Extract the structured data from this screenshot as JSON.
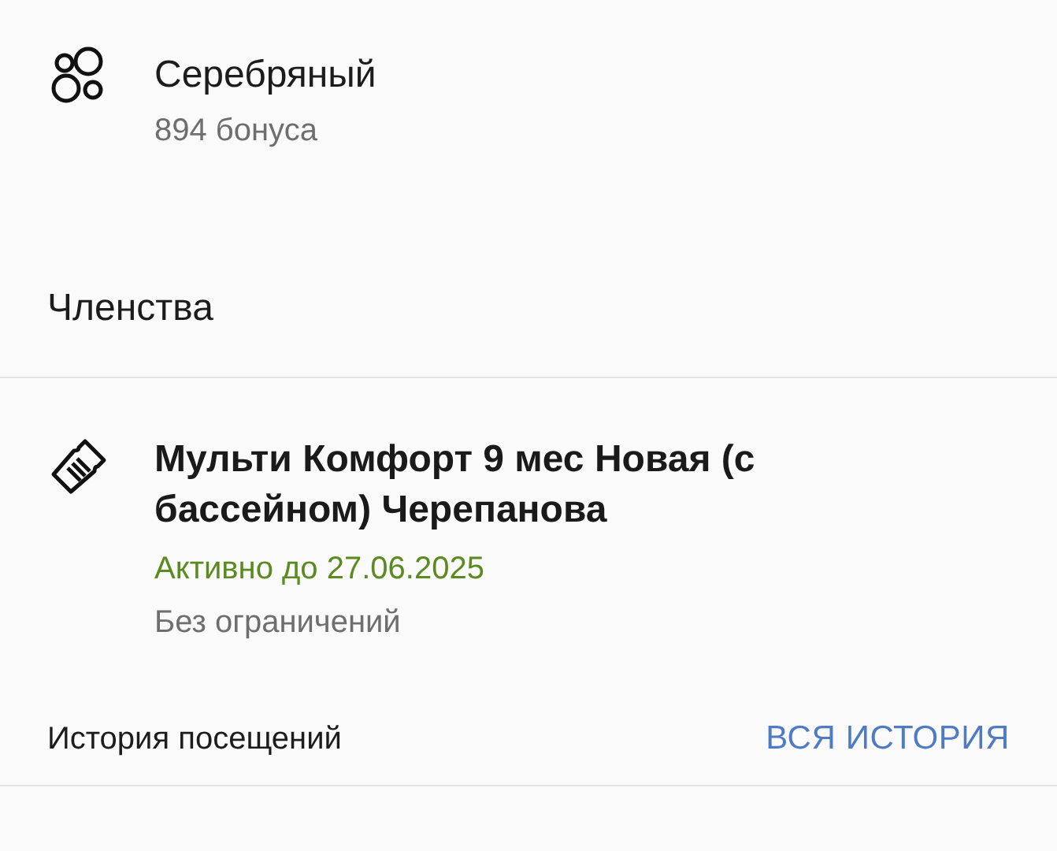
{
  "loyalty": {
    "level": "Серебряный",
    "bonuses": "894 бонуса"
  },
  "memberships_header": "Членства",
  "memberships": [
    {
      "title": "Мульти Комфорт 9 мес Новая (с бассейном) Черепанова",
      "status": "Активно до 27.06.2025",
      "active": true,
      "limit": "Без ограничений"
    }
  ],
  "history": {
    "label": "История посещений",
    "link": "ВСЯ ИСТОРИЯ"
  }
}
